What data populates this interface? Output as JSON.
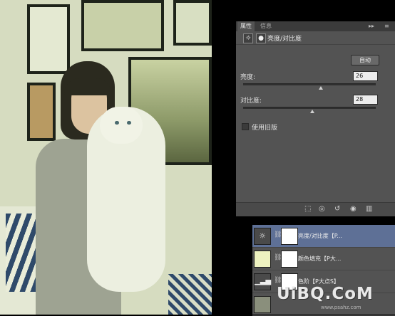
{
  "properties_panel": {
    "tabs": [
      "属性",
      "信息"
    ],
    "collapse_icon": "double-chevron-icon",
    "menu_icon": "panel-menu-icon",
    "header_title": "亮度/对比度",
    "auto_button": "自动",
    "brightness_label": "亮度:",
    "brightness_value": "26",
    "brightness_level": 26,
    "contrast_label": "对比度:",
    "contrast_value": "28",
    "contrast_level": 28,
    "legacy_label": "使用旧版",
    "legacy_checked": false
  },
  "layers_panel": {
    "layers": [
      {
        "name": "亮度/对比度【P...",
        "selected": true
      },
      {
        "name": "颜色填充【P大...",
        "selected": false
      },
      {
        "name": "色阶【P大点S】",
        "selected": false
      },
      {
        "name": "",
        "selected": false
      }
    ]
  },
  "colors": {
    "panel": "#535353",
    "selection": "#5e7096",
    "fill_swatch": "#eef2c0"
  },
  "watermark": "UiBQ.CoM",
  "watermark_url": "www.psahz.com"
}
